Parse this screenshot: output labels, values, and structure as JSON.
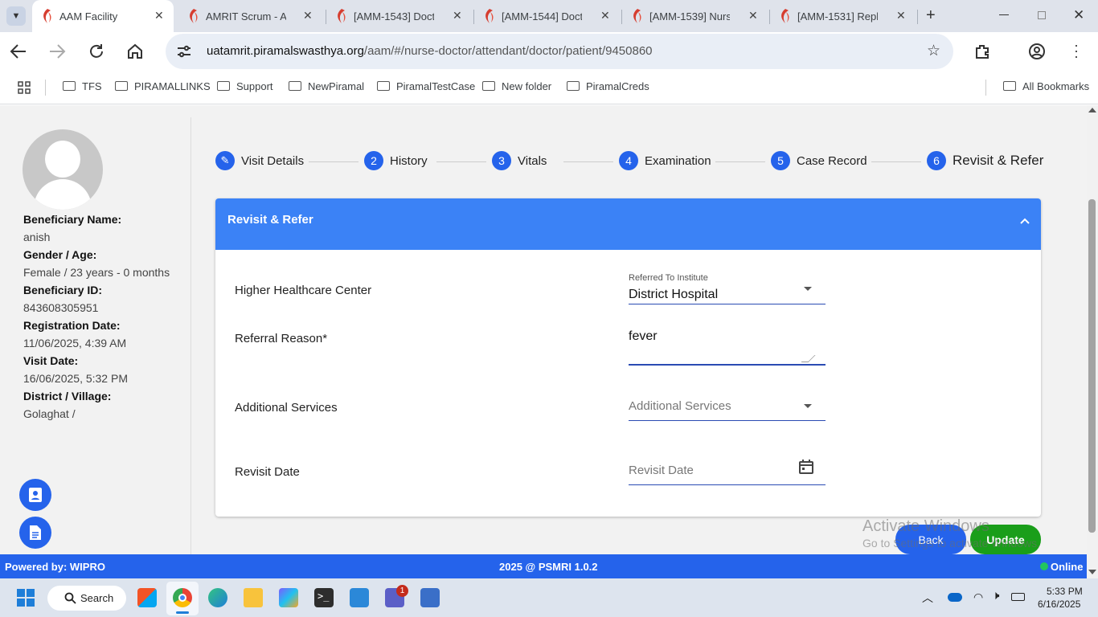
{
  "browser": {
    "tabs": [
      {
        "title": "AAM Facility",
        "active": true
      },
      {
        "title": "AMRIT Scrum - Ag",
        "active": false
      },
      {
        "title": "[AMM-1543] Doct",
        "active": false
      },
      {
        "title": "[AMM-1544] Doct",
        "active": false
      },
      {
        "title": "[AMM-1539] Nurs",
        "active": false
      },
      {
        "title": "[AMM-1531] Repl",
        "active": false
      }
    ],
    "url_domain": "uatamrit.piramalswasthya.org",
    "url_path": "/aam/#/nurse-doctor/attendant/doctor/patient/9450860",
    "bookmarks": [
      "TFS",
      "PIRAMALLINKS",
      "Support",
      "NewPiramal",
      "PiramalTestCase",
      "New folder",
      "PiramalCreds"
    ],
    "all_bookmarks": "All Bookmarks"
  },
  "beneficiary": {
    "name_label": "Beneficiary Name:",
    "name": "anish",
    "gender_label": "Gender / Age:",
    "gender_age": "Female / 23 years - 0 months",
    "id_label": "Beneficiary ID:",
    "id": "843608305951",
    "reg_label": "Registration Date:",
    "reg_date": "11/06/2025, 4:39 AM",
    "visit_label": "Visit Date:",
    "visit_date": "16/06/2025, 5:32 PM",
    "district_label": "District / Village:",
    "district": "Golaghat /"
  },
  "steps": [
    {
      "num": "✎",
      "label": "Visit Details"
    },
    {
      "num": "2",
      "label": "History"
    },
    {
      "num": "3",
      "label": "Vitals"
    },
    {
      "num": "4",
      "label": "Examination"
    },
    {
      "num": "5",
      "label": "Case Record"
    },
    {
      "num": "6",
      "label": "Revisit & Refer"
    }
  ],
  "card": {
    "title": "Revisit & Refer",
    "rows": {
      "higher_center_label": "Higher Healthcare Center",
      "institute_float": "Referred To Institute",
      "institute_value": "District Hospital",
      "reason_label": "Referral Reason*",
      "reason_value": "fever",
      "services_label": "Additional Services",
      "services_placeholder": "Additional Services",
      "revisit_label": "Revisit Date",
      "revisit_placeholder": "Revisit Date"
    }
  },
  "buttons": {
    "back": "Back",
    "update": "Update"
  },
  "watermark": {
    "line1": "Activate Windows",
    "line2": "Go to Settings to activate Windows."
  },
  "footer": {
    "left": "Powered by: WIPRO",
    "center": "2025 @ PSMRI 1.0.2",
    "right": "Online"
  },
  "taskbar": {
    "search": "Search",
    "time": "5:33 PM",
    "date": "6/16/2025",
    "teams_badge": "1"
  },
  "colors": {
    "primary": "#2563eb",
    "header": "#3b82f6",
    "update": "#1a9e1a",
    "online": "#22c55e"
  }
}
